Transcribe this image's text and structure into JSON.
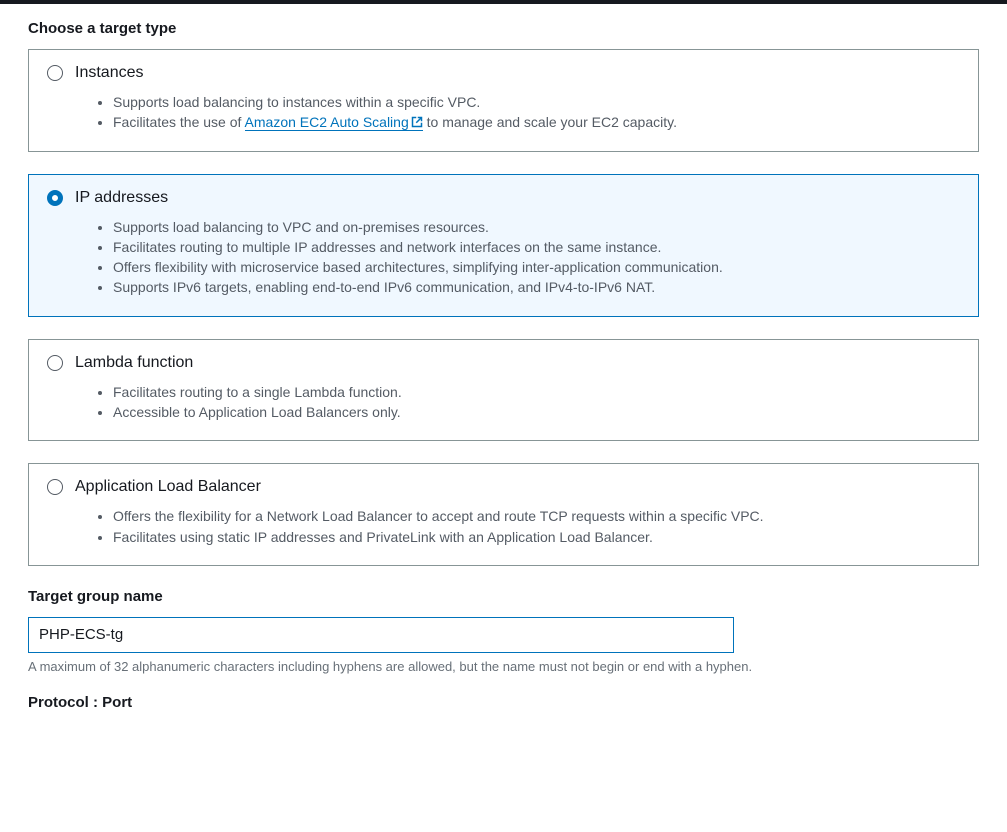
{
  "heading": "Choose a target type",
  "options": {
    "instances": {
      "title": "Instances",
      "b1_pre": "Supports load balancing to instances within a specific VPC.",
      "b2_pre": "Facilitates the use of ",
      "b2_link": "Amazon EC2 Auto Scaling",
      "b2_post": " to manage and scale your EC2 capacity."
    },
    "ip": {
      "title": "IP addresses",
      "b1": "Supports load balancing to VPC and on-premises resources.",
      "b2": "Facilitates routing to multiple IP addresses and network interfaces on the same instance.",
      "b3": "Offers flexibility with microservice based architectures, simplifying inter-application communication.",
      "b4": "Supports IPv6 targets, enabling end-to-end IPv6 communication, and IPv4-to-IPv6 NAT."
    },
    "lambda": {
      "title": "Lambda function",
      "b1": "Facilitates routing to a single Lambda function.",
      "b2": "Accessible to Application Load Balancers only."
    },
    "alb": {
      "title": "Application Load Balancer",
      "b1": "Offers the flexibility for a Network Load Balancer to accept and route TCP requests within a specific VPC.",
      "b2": "Facilitates using static IP addresses and PrivateLink with an Application Load Balancer."
    }
  },
  "targetGroupName": {
    "label": "Target group name",
    "value": "PHP-ECS-tg",
    "hint": "A maximum of 32 alphanumeric characters including hyphens are allowed, but the name must not begin or end with a hyphen."
  },
  "protocolPortLabel": "Protocol : Port"
}
